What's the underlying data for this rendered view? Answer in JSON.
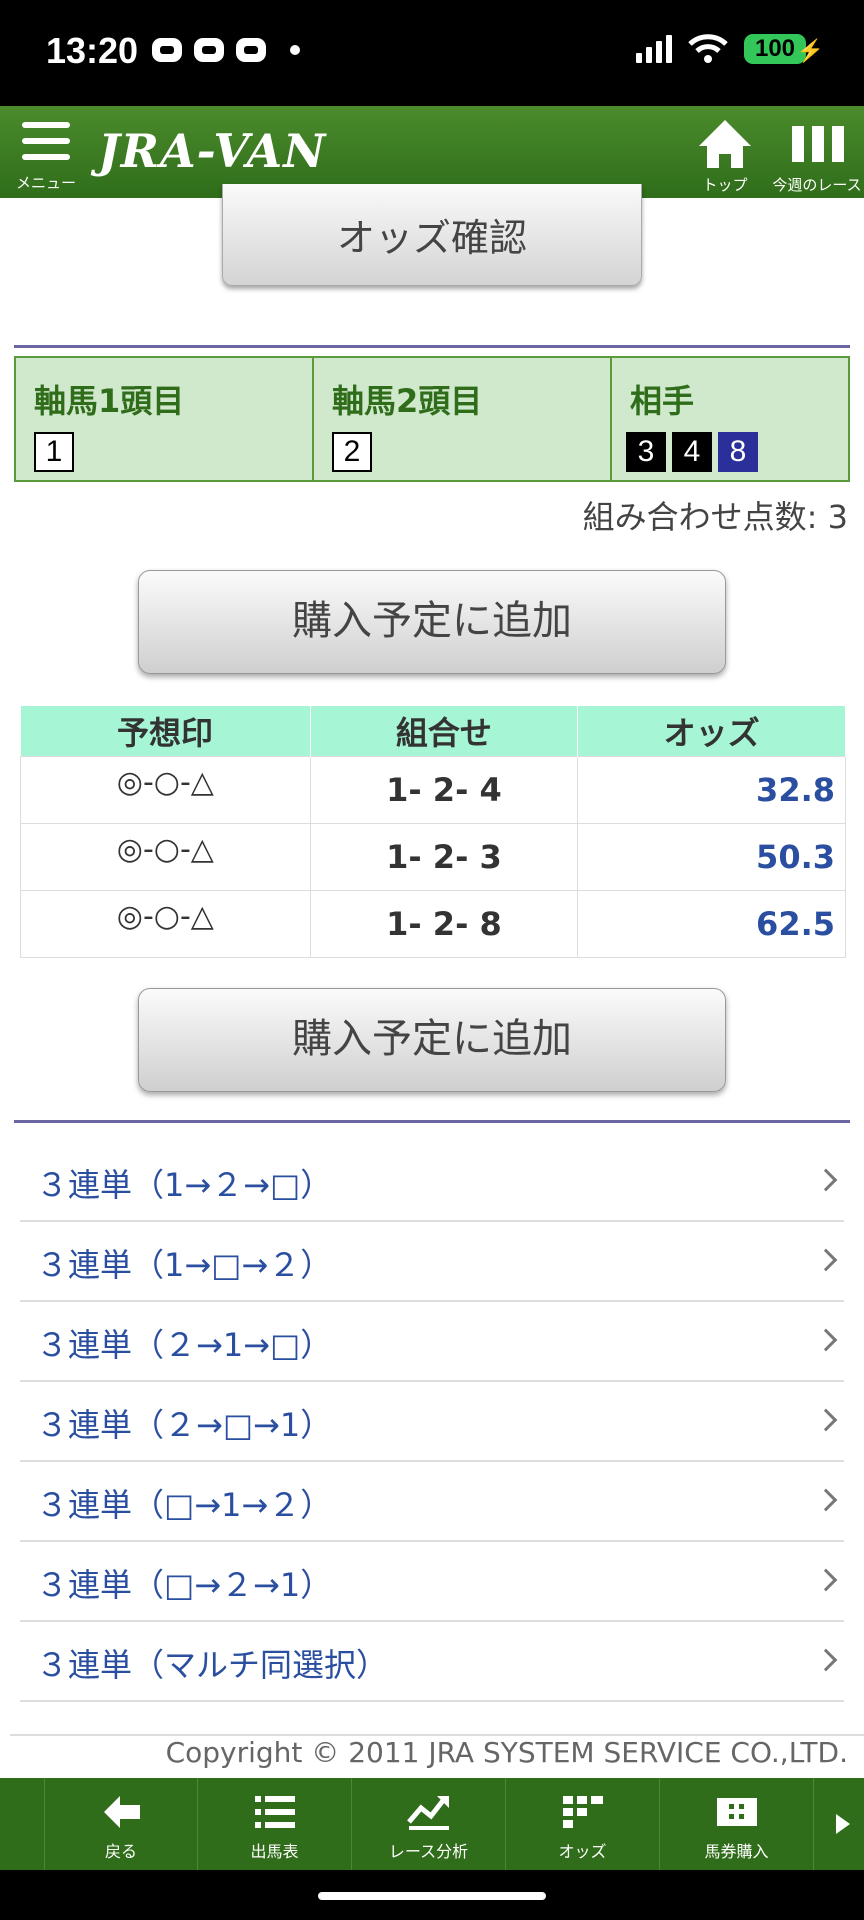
{
  "status_bar": {
    "time": "13:20",
    "battery": "100"
  },
  "header": {
    "menu_label": "メニュー",
    "logo": "JRA-VAN",
    "home_label": "トップ",
    "race_label": "今週のレース"
  },
  "odds_confirm_label": "オッズ確認",
  "axis": {
    "first_title": "軸馬1頭目",
    "first_horse": "1",
    "second_title": "軸馬2頭目",
    "second_horse": "2",
    "partner_title": "相手",
    "partners": [
      "3",
      "4",
      "8"
    ]
  },
  "combo_count": "組み合わせ点数: 3",
  "add_button_label": "購入予定に追加",
  "odds_table": {
    "headers": [
      "予想印",
      "組合せ",
      "オッズ"
    ],
    "rows": [
      {
        "mark": "◎-○-△",
        "combo": "1- 2- 4",
        "odds": "32.8"
      },
      {
        "mark": "◎-○-△",
        "combo": "1- 2- 3",
        "odds": "50.3"
      },
      {
        "mark": "◎-○-△",
        "combo": "1- 2- 8",
        "odds": "62.5"
      }
    ]
  },
  "links": [
    "３連単（1→２→□）",
    "３連単（1→□→２）",
    "３連単（２→1→□）",
    "３連単（２→□→1）",
    "３連単（□→1→２）",
    "３連単（□→２→1）",
    "３連単（マルチ同選択）"
  ],
  "copyright": "Copyright © 2011 JRA SYSTEM SERVICE CO.,LTD.",
  "bottom_nav": [
    "戻る",
    "出馬表",
    "レース分析",
    "オッズ",
    "馬券購入"
  ],
  "colors": {
    "header_green": "#2f6d1a",
    "odds_blue": "#2a4ea0",
    "table_header": "#a6f6d6",
    "axis_bg": "#d0e8cc"
  }
}
